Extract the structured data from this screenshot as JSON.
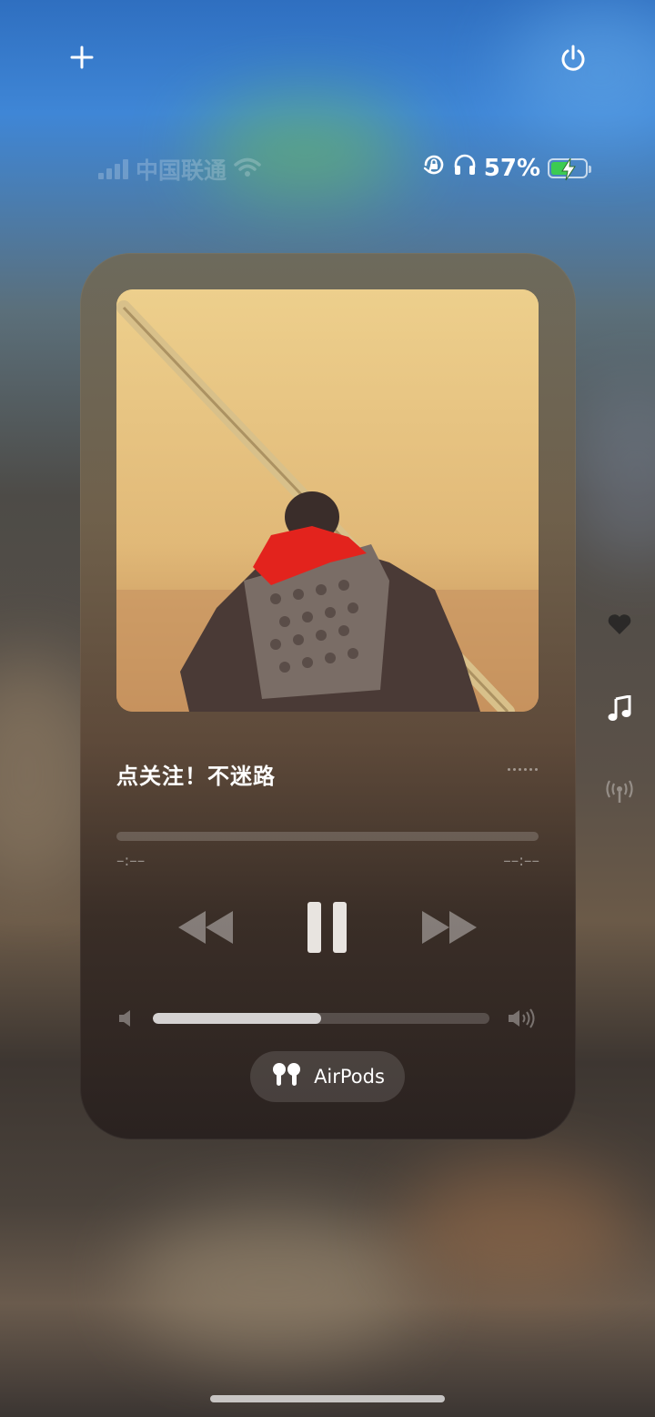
{
  "top_bar": {
    "add_icon": "plus-icon",
    "power_icon": "power-icon"
  },
  "status_bar": {
    "carrier": "中国联通",
    "battery_percent": "57%",
    "battery_level": 0.57,
    "charging": true,
    "icons": [
      "signal-bars-icon",
      "wifi-icon",
      "rotation-lock-icon",
      "headphones-icon",
      "battery-icon"
    ]
  },
  "now_playing": {
    "title": "点关注！不迷路",
    "elapsed": "–:––",
    "remaining": "––:––",
    "progress": 0,
    "volume_level": 0.5,
    "route_label": "AirPods",
    "controls": [
      "rewind-icon",
      "pause-icon",
      "fast-forward-icon"
    ]
  },
  "side_buttons": [
    "heart-icon",
    "music-note-icon",
    "broadcast-icon"
  ],
  "colors": {
    "battery_green": "#3ccb52",
    "card_bg": "#5e4a3a"
  }
}
